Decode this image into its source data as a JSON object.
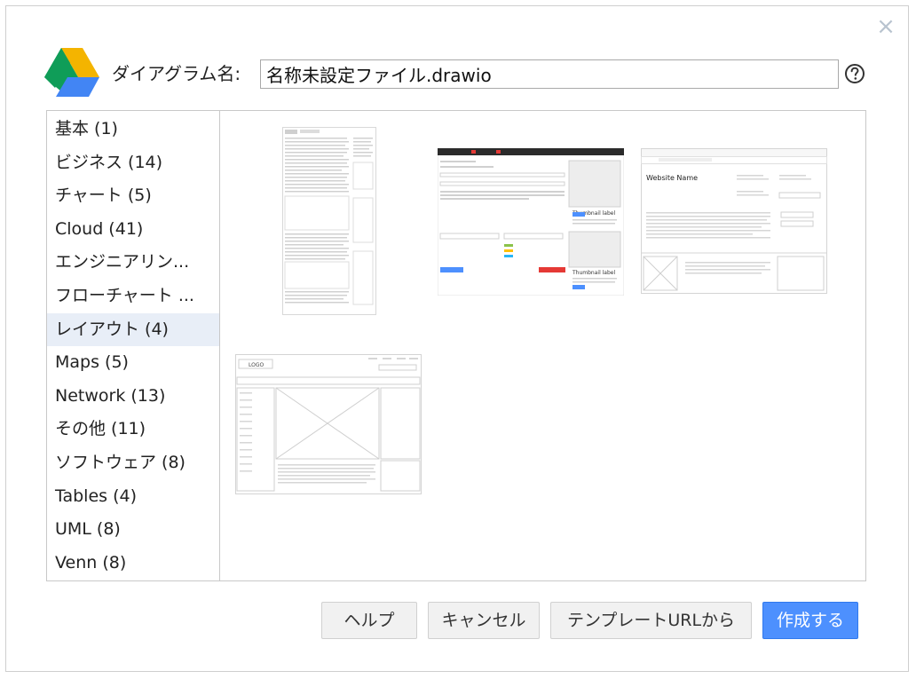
{
  "dialog": {
    "close_symbol": "×",
    "name_label": "ダイアグラム名:",
    "name_value": "名称未設定ファイル.drawio",
    "help_icon": "question-circle-icon",
    "logo_icon": "google-drive-logo"
  },
  "categories": [
    {
      "label": "基本 (1)"
    },
    {
      "label": "ビジネス (14)"
    },
    {
      "label": "チャート (5)"
    },
    {
      "label": "Cloud (41)"
    },
    {
      "label": "エンジニアリン..."
    },
    {
      "label": "フローチャート ..."
    },
    {
      "label": "レイアウト (4)",
      "selected": true
    },
    {
      "label": "Maps (5)"
    },
    {
      "label": "Network (13)"
    },
    {
      "label": "その他 (11)"
    },
    {
      "label": "ソフトウェア (8)"
    },
    {
      "label": "Tables (4)"
    },
    {
      "label": "UML (8)"
    },
    {
      "label": "Venn (8)"
    }
  ],
  "thumbnails": {
    "count": 4,
    "items": [
      {
        "kind": "document-layout"
      },
      {
        "kind": "form-layout",
        "label": "Thumbnail label"
      },
      {
        "kind": "website-layout",
        "title": "Website Name"
      },
      {
        "kind": "page-layout",
        "logo": "LOGO"
      }
    ]
  },
  "buttons": {
    "help": "ヘルプ",
    "cancel": "キャンセル",
    "template_url": "テンプレートURLから",
    "create": "作成する"
  },
  "colors": {
    "accent": "#4d90fe",
    "selected_bg": "#e8eef7",
    "drive_green": "#0f9d58",
    "drive_yellow": "#f4b400",
    "drive_blue": "#4285f4"
  }
}
